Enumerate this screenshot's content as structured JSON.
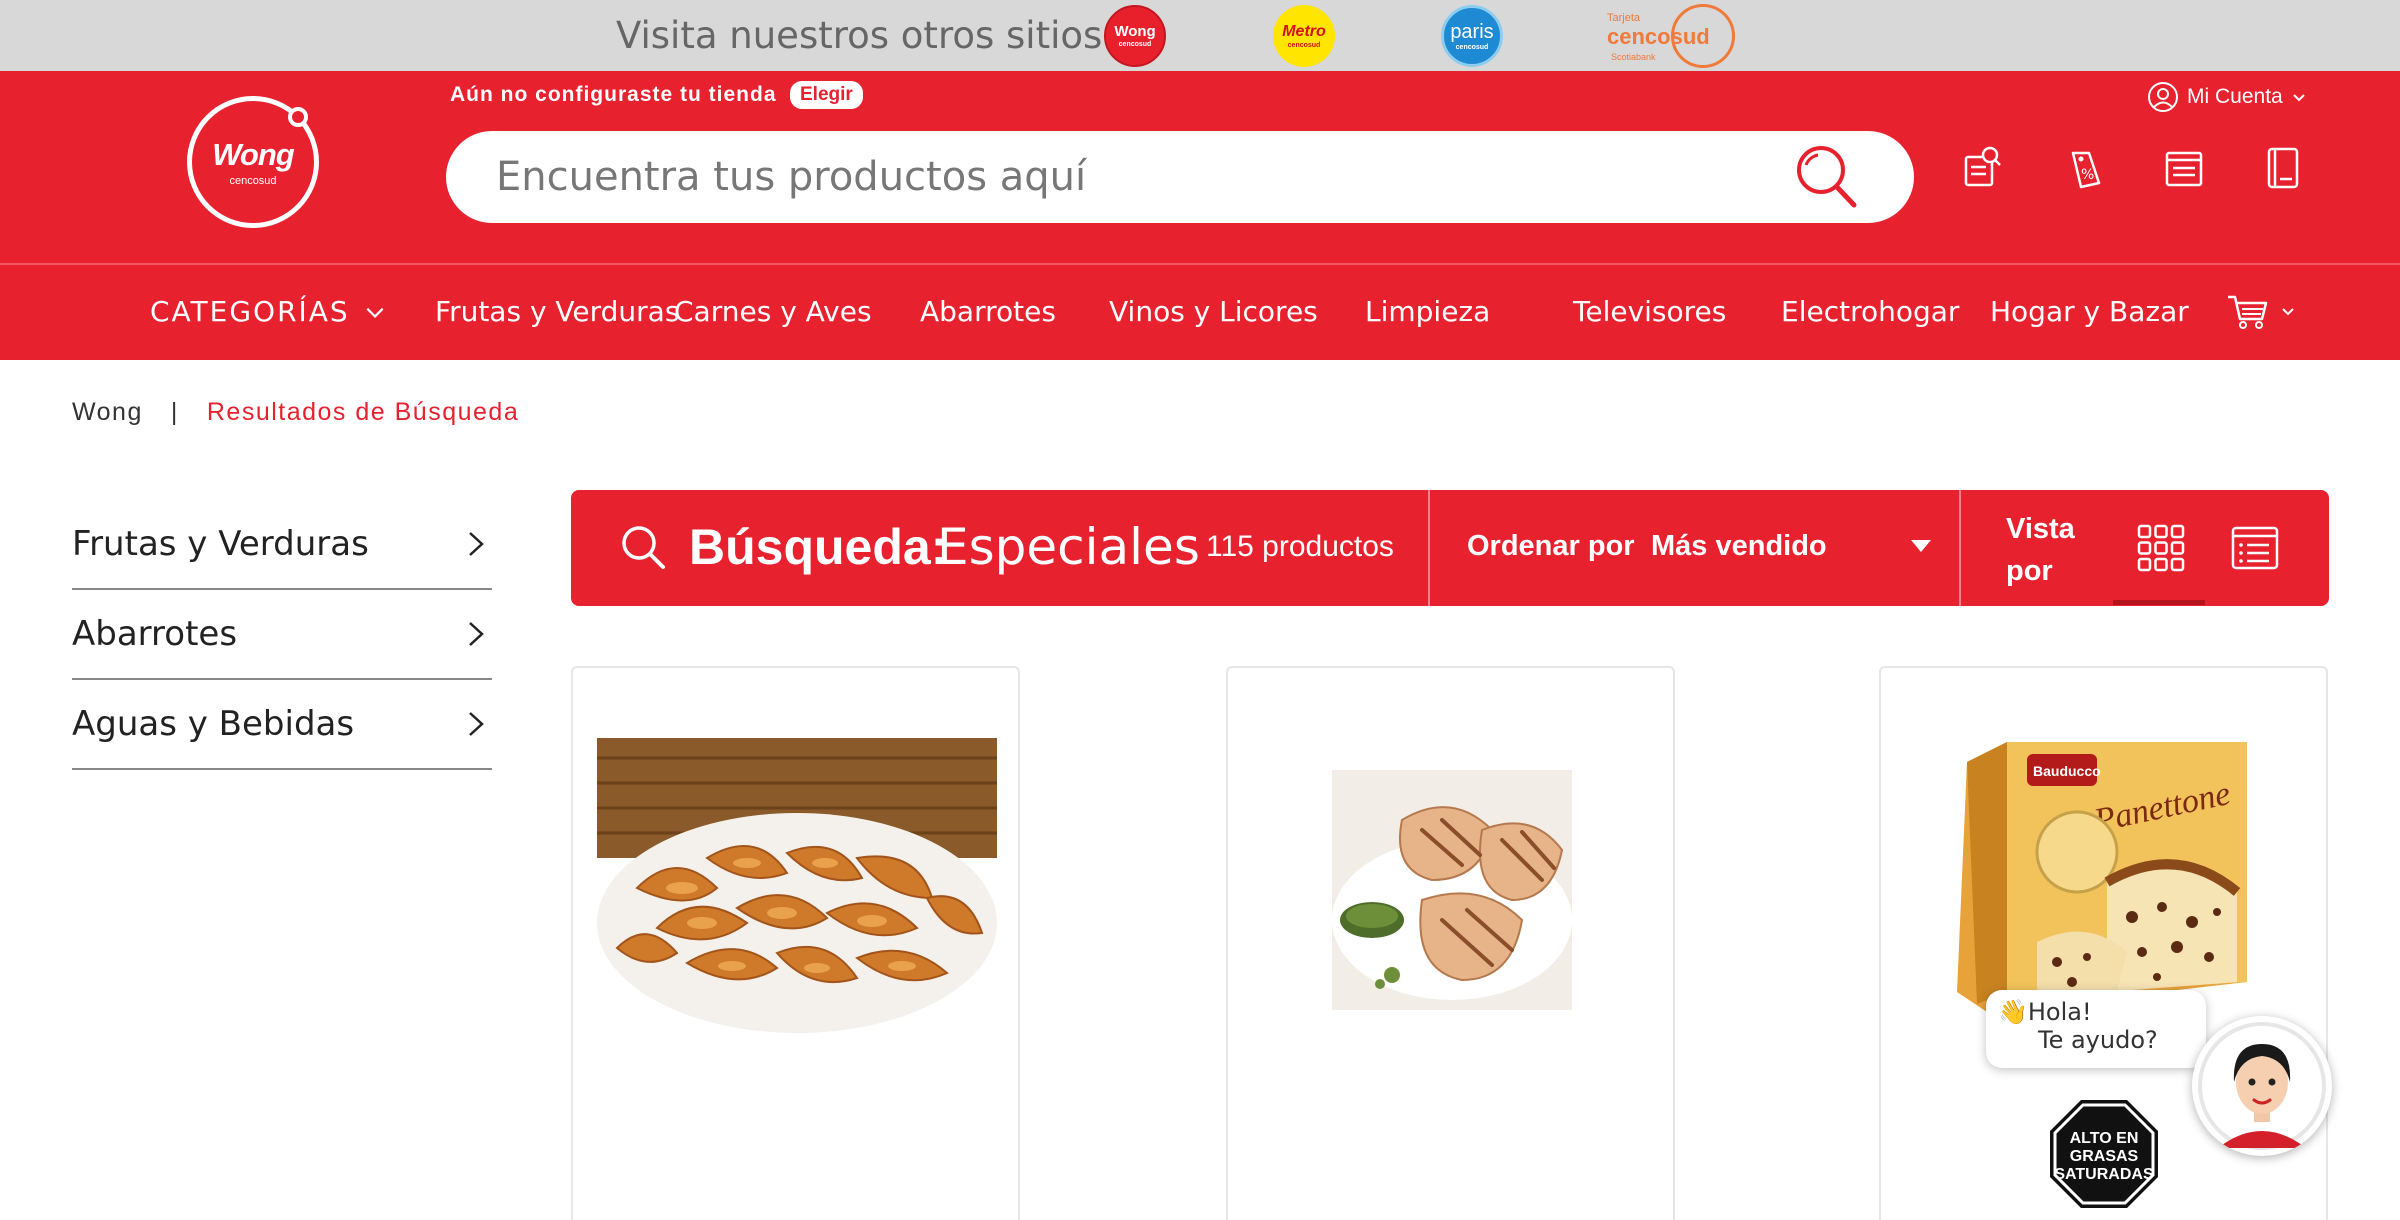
{
  "topbar": {
    "visit_text": "Visita nuestros otros sitios:",
    "sites": [
      {
        "name": "Wong",
        "sub": "cencosud"
      },
      {
        "name": "Metro",
        "sub": "cencosud"
      },
      {
        "name": "paris",
        "sub": "cencosud"
      },
      {
        "line1": "Tarjeta",
        "line2": "cencosud",
        "line3": "Scotiabank"
      }
    ]
  },
  "header": {
    "logo_name": "Wong",
    "logo_sub": "cencosud",
    "store_text": "Aún no configuraste tu tienda",
    "store_button": "Elegir",
    "account_label": "Mi Cuenta",
    "search_placeholder": "Encuentra tus productos aquí",
    "icons": [
      "search-list-icon",
      "promo-tag-icon",
      "list-icon",
      "notebook-icon"
    ]
  },
  "nav": {
    "categories_label": "CATEGORÍAS",
    "items": [
      "Frutas y Verduras",
      "Carnes y Aves",
      "Abarrotes",
      "Vinos y Licores",
      "Limpieza",
      "Televisores",
      "Electrohogar",
      "Hogar y Bazar"
    ]
  },
  "breadcrumb": {
    "home": "Wong",
    "separator": "|",
    "current": "Resultados de Búsqueda"
  },
  "sidebar": {
    "items": [
      {
        "label": "Frutas y Verduras"
      },
      {
        "label": "Abarrotes"
      },
      {
        "label": "Aguas y Bebidas"
      }
    ]
  },
  "results": {
    "search_label": "Búsqueda:",
    "search_term": "Especiales",
    "count": "115 productos",
    "order_label": "Ordenar por",
    "order_value": "Más vendido",
    "view_label": "Vista por",
    "view_modes": [
      "grid-view-icon",
      "list-view-icon"
    ],
    "active_view": "grid"
  },
  "products": [
    {
      "image": "papas-fritas"
    },
    {
      "image": "pollo-parrilla"
    },
    {
      "image": "panettone-bauducco",
      "brand": "Bauducco",
      "name": "Panettone",
      "warning": [
        "ALTO EN",
        "GRASAS",
        "SATURADAS"
      ]
    }
  ],
  "chat": {
    "greeting": "👋Hola!",
    "question": "Te ayudo?"
  },
  "colors": {
    "brand_red": "#e8212f",
    "topbar_gray": "#d8d8d8"
  }
}
